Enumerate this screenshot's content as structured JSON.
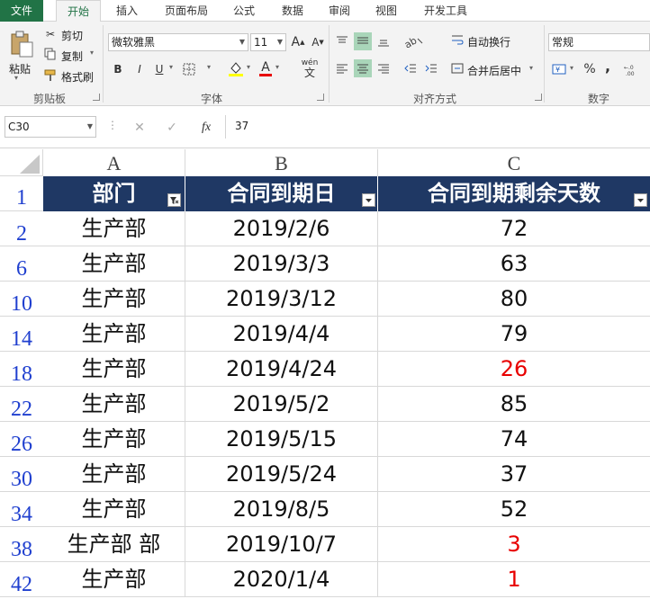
{
  "menu": {
    "tabs": [
      "文件",
      "开始",
      "插入",
      "页面布局",
      "公式",
      "数据",
      "审阅",
      "视图",
      "开发工具"
    ],
    "active": "开始"
  },
  "ribbon": {
    "clipboard": {
      "paste": "粘贴",
      "cut": "剪切",
      "copy": "复制",
      "format_painter": "格式刷",
      "group": "剪贴板"
    },
    "font": {
      "name": "微软雅黑",
      "size": "11",
      "bold": "B",
      "italic": "I",
      "underline": "U",
      "phonetic": "wén",
      "group": "字体"
    },
    "align": {
      "wrap": "自动换行",
      "merge": "合并后居中",
      "group": "对齐方式"
    },
    "number": {
      "format": "常规",
      "percent": "%",
      "comma": ",",
      "group": "数字"
    }
  },
  "formula_bar": {
    "name_box": "C30",
    "fx": "fx",
    "value": "37"
  },
  "columns": [
    "A",
    "B",
    "C"
  ],
  "table": {
    "headers": [
      "部门",
      "合同到期日",
      "合同到期剩余天数"
    ],
    "rows": [
      {
        "row": "2",
        "dept": "生产部",
        "date": "2019/2/6",
        "days": "72",
        "red": false
      },
      {
        "row": "6",
        "dept": "生产部",
        "date": "2019/3/3",
        "days": "63",
        "red": false
      },
      {
        "row": "10",
        "dept": "生产部",
        "date": "2019/3/12",
        "days": "80",
        "red": false
      },
      {
        "row": "14",
        "dept": "生产部",
        "date": "2019/4/4",
        "days": "79",
        "red": false
      },
      {
        "row": "18",
        "dept": "生产部",
        "date": "2019/4/24",
        "days": "26",
        "red": true
      },
      {
        "row": "22",
        "dept": "生产部",
        "date": "2019/5/2",
        "days": "85",
        "red": false
      },
      {
        "row": "26",
        "dept": "生产部",
        "date": "2019/5/15",
        "days": "74",
        "red": false
      },
      {
        "row": "30",
        "dept": "生产部",
        "date": "2019/5/24",
        "days": "37",
        "red": false
      },
      {
        "row": "34",
        "dept": "生产部",
        "date": "2019/8/5",
        "days": "52",
        "red": false
      },
      {
        "row": "38",
        "dept": "生产部 部",
        "date": "2019/10/7",
        "days": "3",
        "red": true
      },
      {
        "row": "42",
        "dept": "生产部",
        "date": "2020/1/4",
        "days": "1",
        "red": true
      }
    ],
    "header_row": "1",
    "red_color": "#e80000",
    "header_fill": "#1f3864"
  }
}
